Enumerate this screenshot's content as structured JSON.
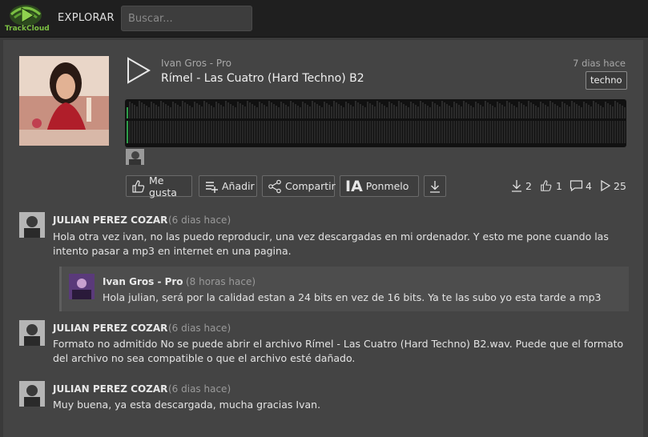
{
  "header": {
    "logo_text": "TrackCloud",
    "nav_explore": "EXPLORAR",
    "search_placeholder": "Buscar..."
  },
  "track": {
    "artist": "Ivan Gros - Pro",
    "title": "Rímel - Las Cuatro (Hard Techno) B2",
    "date": "7 dias hace",
    "tag": "techno"
  },
  "actions": {
    "like": "Me gusta",
    "add": "Añadir",
    "share": "Compartir",
    "ia_label": "IA",
    "ia_text": "Ponmelo"
  },
  "stats": {
    "downloads": "2",
    "likes": "1",
    "comments": "4",
    "plays": "25"
  },
  "comments": [
    {
      "author": "JULIAN PEREZ COZAR",
      "time": "(6 dias hace)",
      "line1": "Hola otra vez ivan, no las puedo reproducir, una vez descargadas en mi ordenador. Y esto me pone cuando las",
      "line2": "intento pasar a mp3 en internet en una pagina."
    },
    {
      "author": "Ivan Gros - Pro",
      "time": "(8 horas hace)",
      "line1": "Hola julian, será por la calidad estan a 24 bits en vez de 16 bits. Ya te las subo yo esta tarde a mp3"
    },
    {
      "author": "JULIAN PEREZ COZAR",
      "time": "(6 dias hace)",
      "line1": "Formato no admitido No se puede abrir el archivo Rímel - Las Cuatro (Hard Techno) B2.wav. Puede que el formato",
      "line2": "del archivo no sea compatible o que el archivo esté dañado."
    },
    {
      "author": "JULIAN PEREZ COZAR",
      "time": "(6 dias hace)",
      "line1": "Muy buena, ya esta descargada, mucha gracias Ivan."
    }
  ],
  "colors": {
    "accent_green": "#7cc043",
    "waveform_played": "#2e9e4a",
    "background": "#3a3a3a"
  }
}
